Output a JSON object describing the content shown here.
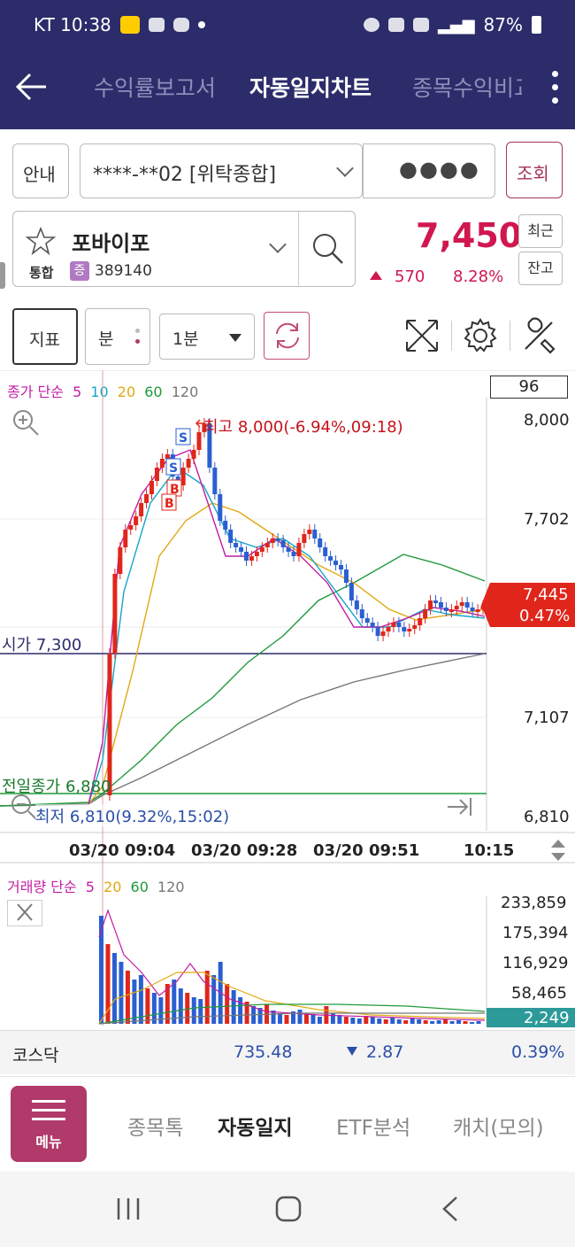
{
  "status": {
    "carrier_time": "KT 10:38",
    "battery": "87%"
  },
  "tabs": [
    {
      "label": "수익률보고서",
      "active": false
    },
    {
      "label": "자동일지차트",
      "active": true
    },
    {
      "label": "종목수익비교",
      "active": false
    }
  ],
  "account": {
    "guide_label": "안내",
    "account_value": "****-**02 [위탁종합]",
    "password_mask": "●●●●",
    "query_label": "조회"
  },
  "stock": {
    "name": "포바이포",
    "market": "통합",
    "badge": "증",
    "code": "389140",
    "price": "7,450",
    "change": "570",
    "change_pct": "8.28%",
    "recent_label": "최근",
    "balance_label": "잔고"
  },
  "toolbar": {
    "indicator_label": "지표",
    "period_label": "분",
    "interval_value": "1분"
  },
  "main_chart": {
    "ma_legend_prefix": "종가 단순",
    "ma_periods": [
      {
        "label": "5",
        "color": "#c21da3"
      },
      {
        "label": "10",
        "color": "#16a6c9"
      },
      {
        "label": "20",
        "color": "#e3a812"
      },
      {
        "label": "60",
        "color": "#1f9a3a"
      },
      {
        "label": "120",
        "color": "#777777"
      }
    ],
    "count_box": "96",
    "y_ticks": [
      "8,000",
      "7,702",
      "7,107",
      "6,810"
    ],
    "high_label": "최고 8,000(-6.94%,09:18)",
    "low_label": "최저 6,810(9.32%,15:02)",
    "open_label": "시가 7,300",
    "prev_close_label": "전일종가 6,880",
    "current_tag_price": "7,445",
    "current_tag_pct": "0.47%",
    "x_labels": [
      "03/20 09:04",
      "03/20 09:28",
      "03/20 09:51",
      "10:15"
    ],
    "colors": {
      "up": "#e0261b",
      "down": "#2a5fd1"
    }
  },
  "volume_chart": {
    "legend_prefix": "거래량 단순",
    "ma_periods": [
      {
        "label": "5",
        "color": "#c21da3"
      },
      {
        "label": "20",
        "color": "#e3a812"
      },
      {
        "label": "60",
        "color": "#1f9a3a"
      },
      {
        "label": "120",
        "color": "#777777"
      }
    ],
    "y_ticks": [
      "233,859",
      "175,394",
      "116,929",
      "58,465"
    ],
    "current_volume": "2,249"
  },
  "index_bar": {
    "name": "코스닥",
    "value": "735.48",
    "change": "2.87",
    "change_pct": "0.39%"
  },
  "bottom_nav": {
    "menu_label": "메뉴",
    "items": [
      {
        "label": "종목톡",
        "active": false
      },
      {
        "label": "자동일지",
        "active": true
      },
      {
        "label": "ETF분석",
        "active": false
      },
      {
        "label": "캐치(모의)",
        "active": false
      }
    ]
  }
}
